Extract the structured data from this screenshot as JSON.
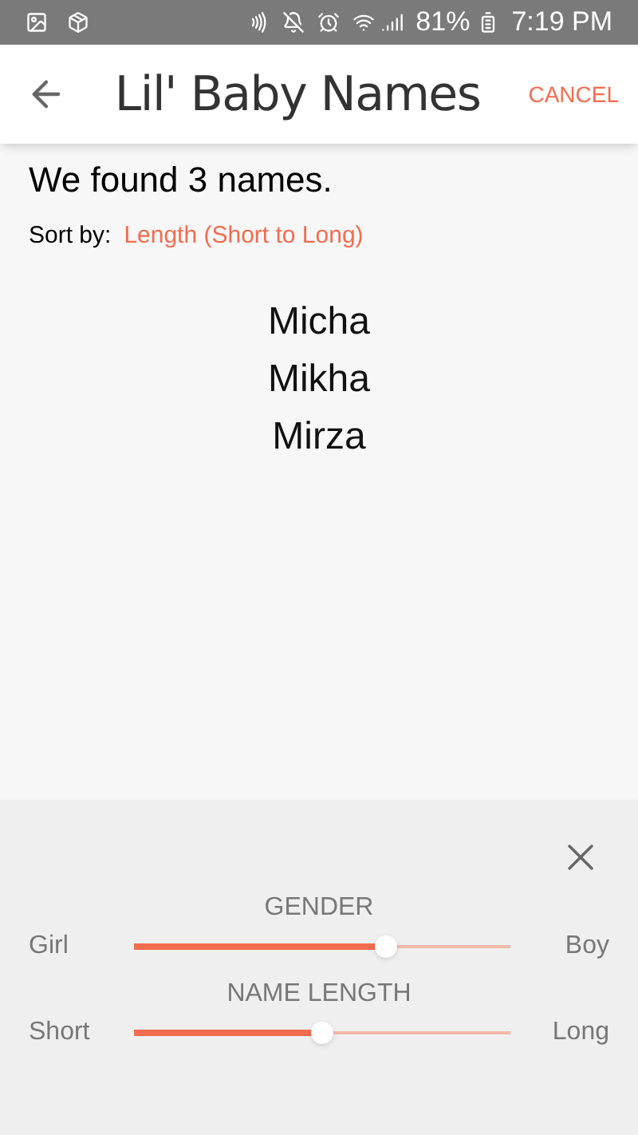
{
  "status_bar": {
    "battery": "81%",
    "time": "7:19 PM"
  },
  "app_bar": {
    "title": "Lil' Baby Names",
    "action": "CANCEL"
  },
  "results": {
    "summary": "We found 3 names.",
    "sort_label": "Sort by:",
    "sort_value": "Length (Short to Long)",
    "names": [
      "Micha",
      "Mikha",
      "Mirza"
    ]
  },
  "filters": {
    "sliders": [
      {
        "title": "GENDER",
        "min_label": "Girl",
        "max_label": "Boy",
        "level": 0.67
      },
      {
        "title": "NAME LENGTH",
        "min_label": "Short",
        "max_label": "Long",
        "level": 0.5
      }
    ]
  }
}
